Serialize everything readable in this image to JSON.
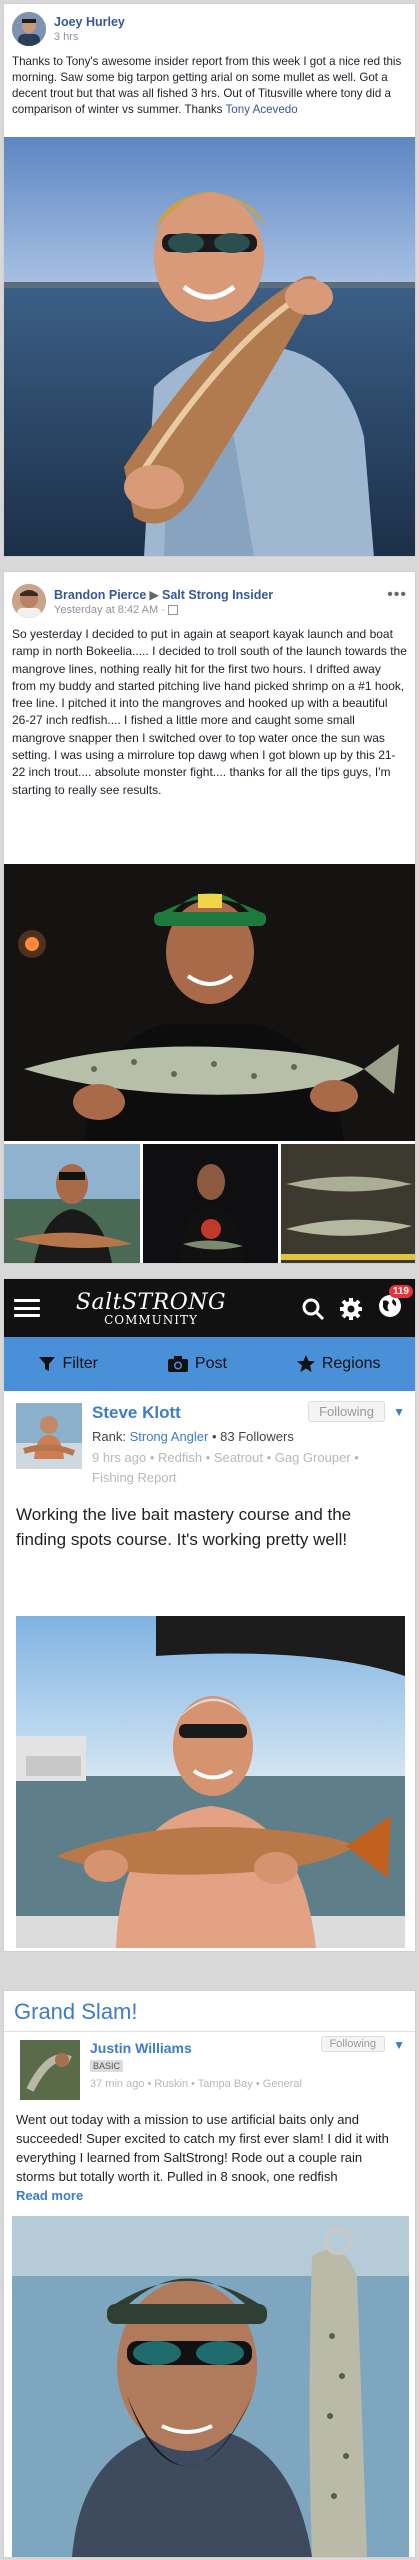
{
  "post1": {
    "author": "Joey Hurley",
    "time": "3 hrs",
    "text": "Thanks to Tony's awesome insider report from this week I got a nice red this morning. Saw some big tarpon getting arial on some mullet as well. Got a decent trout but that was all fished 3 hrs. Out of Titusville where tony did a comparison of winter vs summer. Thanks ",
    "mention": "Tony Acevedo"
  },
  "post2": {
    "author": "Brandon Pierce",
    "group": "Salt Strong Insider",
    "time": "Yesterday at 8:42 AM ·",
    "text": "So yesterday I decided to put in again at seaport kayak launch and boat ramp in north Bokeelia..... I decided to troll south of the launch towards the mangrove lines, nothing really hit for the first two hours. I drifted away from my buddy and started pitching live hand picked shrimp on a #1 hook, free line. I pitched it into the mangroves and hooked up with a beautiful 26-27 inch redfish.... I fished a little more and caught some small mangrove snapper then I switched over to top water once the sun was setting. I was using a mirrolure top dawg when I got blown up by this 21-22 inch trout.... absolute monster fight.... thanks for all the tips guys, I'm starting to really see results."
  },
  "app": {
    "logo_top": "SaltSTRONG",
    "logo_bottom": "COMMUNITY",
    "notif_count": "119",
    "tabs": {
      "filter": "Filter",
      "post": "Post",
      "regions": "Regions"
    },
    "post": {
      "author": "Steve Klott",
      "follow": "Following",
      "rank_label": "Rank: ",
      "rank": "Strong Angler",
      "followers": " • 83 Followers",
      "meta": "9 hrs ago • Redfish • Seatrout • Gag Grouper • Fishing Report",
      "body": "Working the live bait mastery course and the finding spots course. It's working pretty well!"
    }
  },
  "slam": {
    "title": "Grand Slam!",
    "author": "Justin Williams",
    "badge": "BASIC",
    "follow": "Following",
    "meta": "37 min ago • Ruskin • Tampa Bay • General",
    "body": "Went out today with a mission to use artificial baits only and succeeded! Super excited to catch my first ever slam! I did it with everything I learned from SaltStrong! Rode out a couple rain storms but totally worth it. Pulled in 8 snook, one redfish",
    "read_more": "Read more"
  },
  "colors": {
    "fb_link": "#365899",
    "app_blue": "#3d7cc9",
    "tab_blue": "#4a90d9",
    "badge_red": "#e8323a"
  }
}
